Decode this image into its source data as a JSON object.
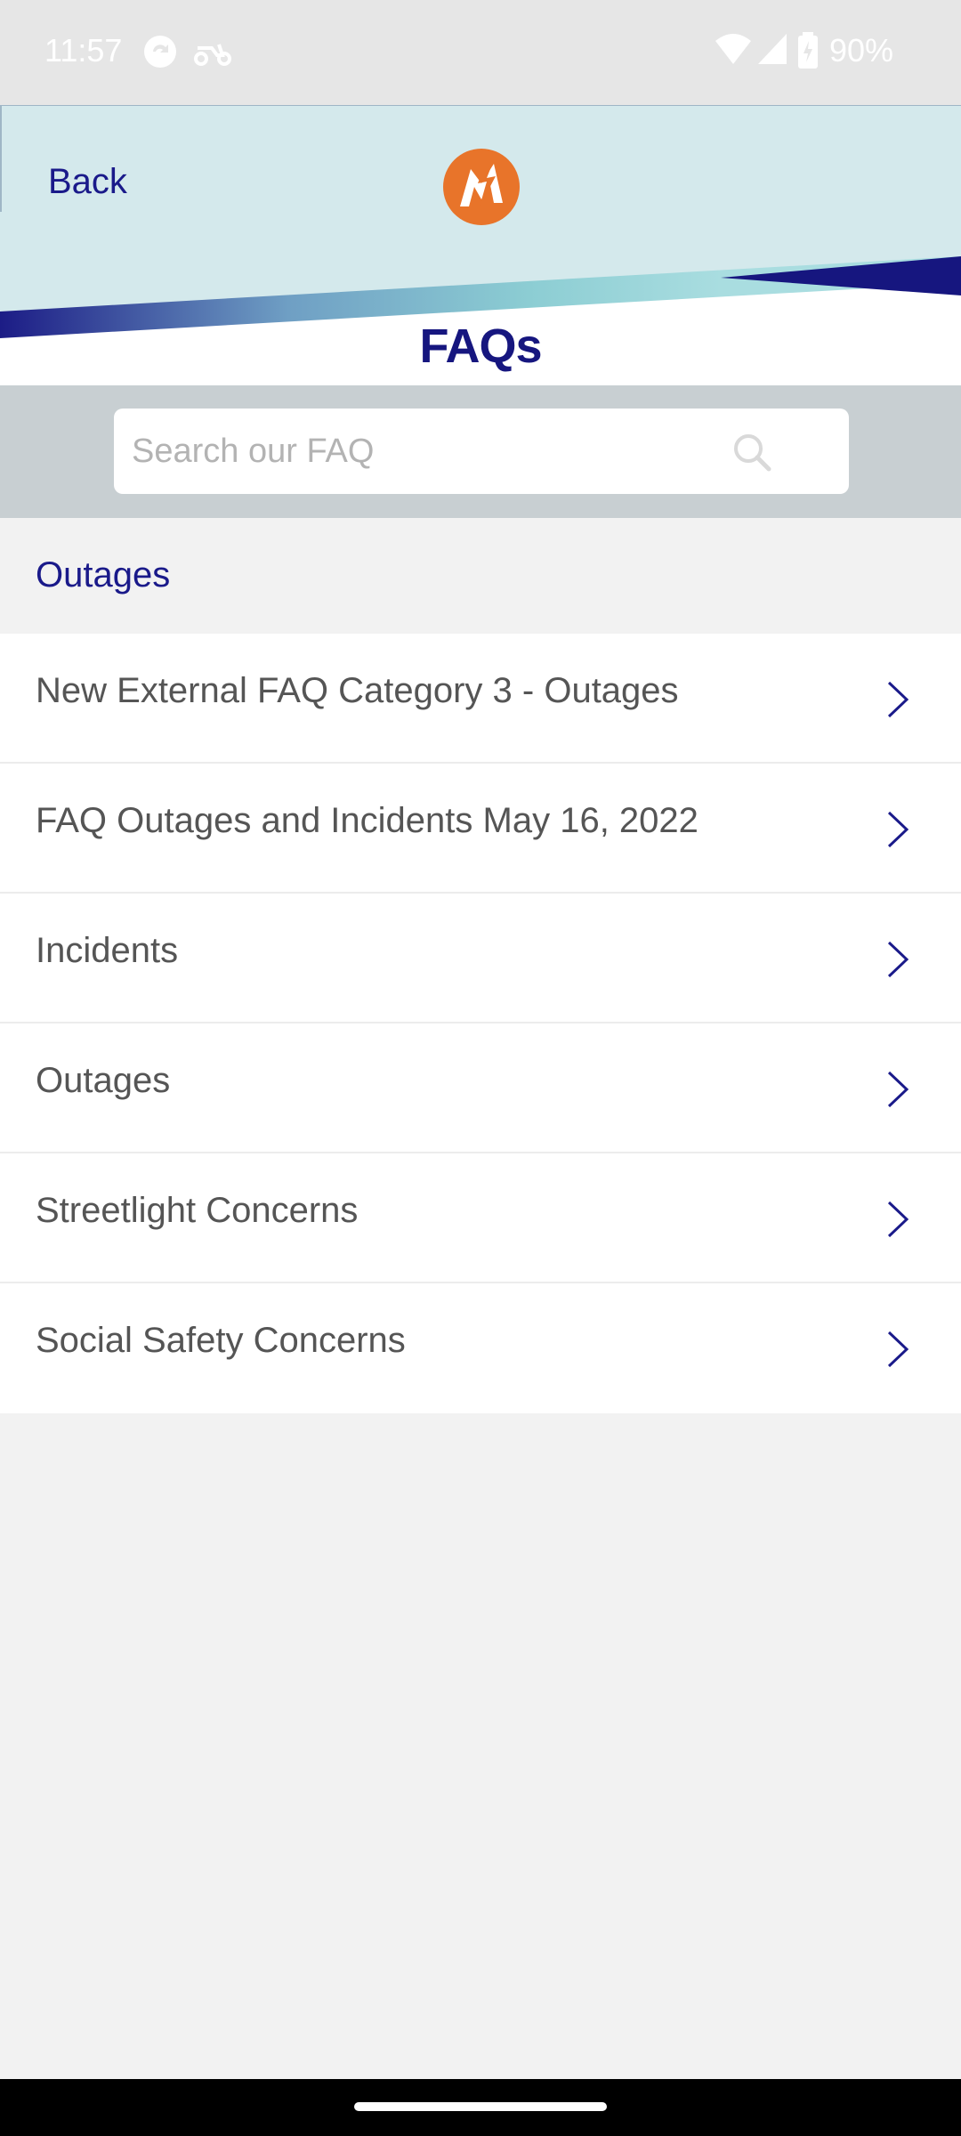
{
  "status_bar": {
    "time": "11:57",
    "battery": "90%"
  },
  "header": {
    "back_label": "Back",
    "title": "FAQs",
    "logo_icon": "brand-logo-icon"
  },
  "search": {
    "placeholder": "Search our FAQ",
    "value": ""
  },
  "section": {
    "title": "Outages"
  },
  "faq_items": [
    {
      "label": "New External FAQ Category 3 - Outages"
    },
    {
      "label": "FAQ Outages and Incidents May 16, 2022"
    },
    {
      "label": "Incidents"
    },
    {
      "label": "Outages"
    },
    {
      "label": "Streetlight Concerns"
    },
    {
      "label": "Social Safety Concerns"
    }
  ],
  "colors": {
    "accent": "#1a1a8a",
    "brand_orange": "#e8742a",
    "header_bg": "#d4e9ec",
    "search_band": "#c8cfd2"
  }
}
